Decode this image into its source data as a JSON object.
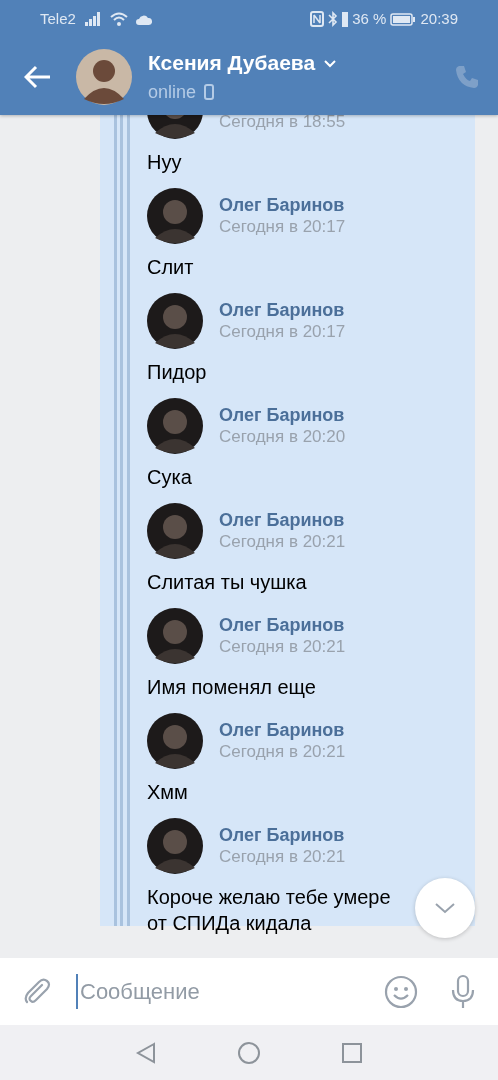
{
  "status_bar": {
    "carrier": "Tele2",
    "battery": "36 %",
    "time": "20:39"
  },
  "header": {
    "name": "Ксения Дубаева",
    "status": "online"
  },
  "messages": [
    {
      "time": "Сегодня в 18:55",
      "lines": [
        "Нуу"
      ]
    },
    {
      "author": "Олег Баринов",
      "time": "Сегодня в 20:17",
      "lines": [
        "Слит"
      ]
    },
    {
      "author": "Олег Баринов",
      "time": "Сегодня в 20:17",
      "lines": [
        "Пидор"
      ]
    },
    {
      "author": "Олег Баринов",
      "time": "Сегодня в 20:20",
      "lines": [
        "Сука"
      ]
    },
    {
      "author": "Олег Баринов",
      "time": "Сегодня в 20:21",
      "lines": [
        "Слитая ты чушка"
      ]
    },
    {
      "author": "Олег Баринов",
      "time": "Сегодня в 20:21",
      "lines": [
        "Имя поменял еще"
      ]
    },
    {
      "author": "Олег Баринов",
      "time": "Сегодня в 20:21",
      "lines": [
        "Хмм"
      ]
    },
    {
      "author": "Олег Баринов",
      "time": "Сегодня в 20:21",
      "lines": [
        "Короче желаю тебе умере",
        "от СПИДа кидала"
      ]
    }
  ],
  "composer": {
    "placeholder": "Сообщение"
  }
}
